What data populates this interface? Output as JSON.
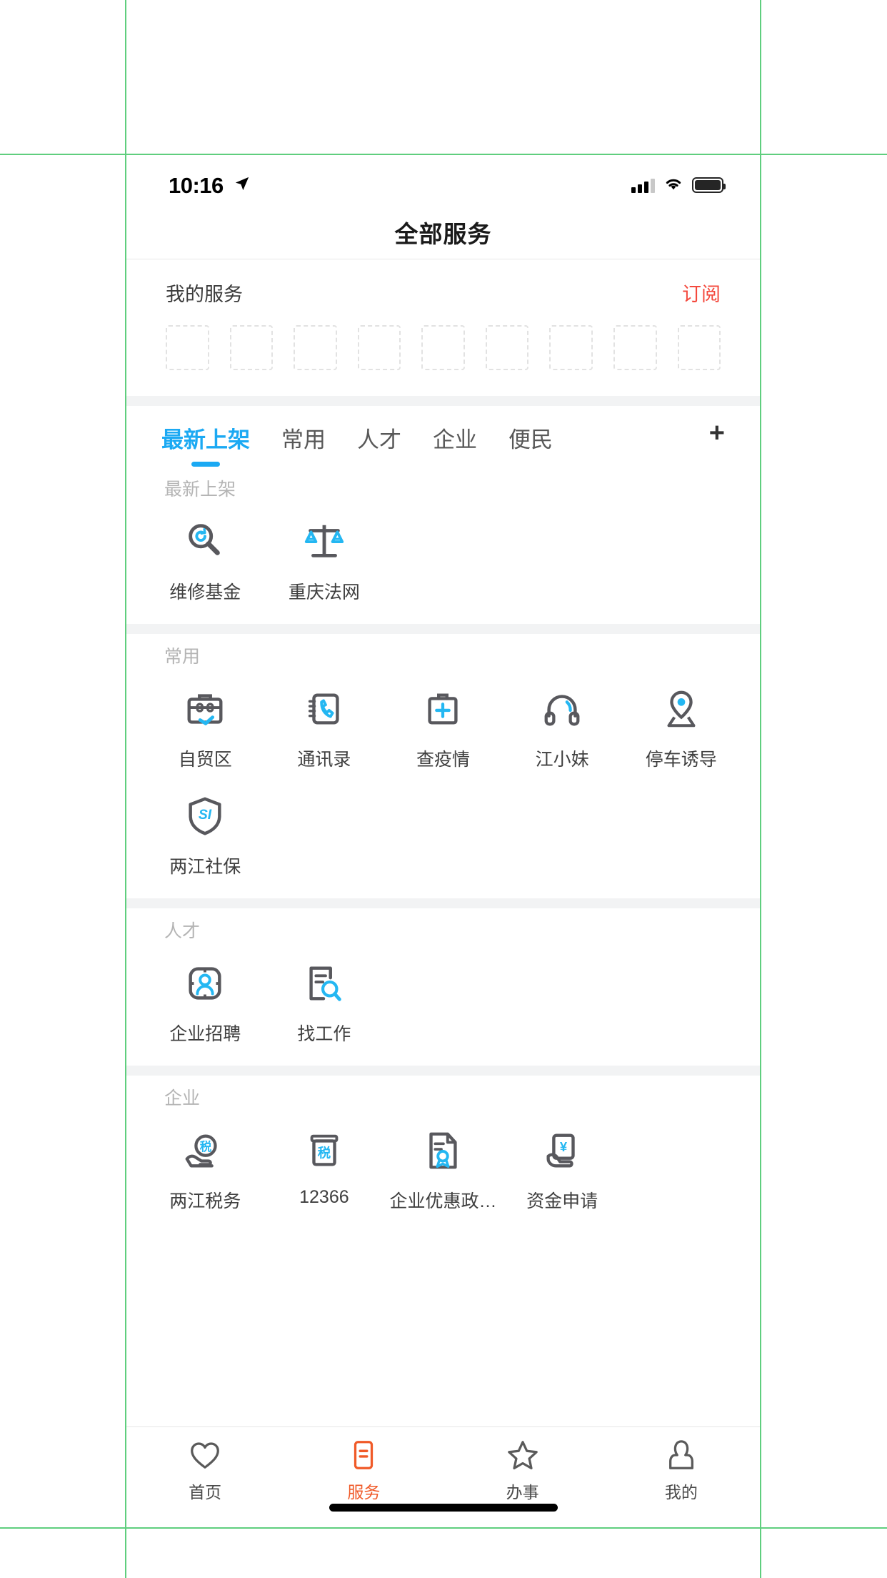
{
  "statusbar": {
    "time": "10:16",
    "location_icon": "location-arrow-icon",
    "signal_icon": "cellular-signal-icon",
    "wifi_icon": "wifi-icon",
    "battery_icon": "battery-icon"
  },
  "navbar": {
    "title": "全部服务"
  },
  "my_services": {
    "title": "我的服务",
    "subscribe_label": "订阅",
    "subscribe_color": "#f4493d",
    "empty_slots": 9
  },
  "tabs": {
    "items": [
      {
        "label": "最新上架",
        "active": true
      },
      {
        "label": "常用",
        "active": false
      },
      {
        "label": "人才",
        "active": false
      },
      {
        "label": "企业",
        "active": false
      },
      {
        "label": "便民",
        "active": false
      }
    ],
    "add_label": "+",
    "active_color": "#1ba9f3"
  },
  "sections": [
    {
      "title": "最新上架",
      "items": [
        {
          "label": "维修基金",
          "icon": "magnifier-refresh-icon"
        },
        {
          "label": "重庆法网",
          "icon": "balance-scale-icon"
        }
      ]
    },
    {
      "title": "常用",
      "items": [
        {
          "label": "自贸区",
          "icon": "briefcase-icon"
        },
        {
          "label": "通讯录",
          "icon": "contact-book-phone-icon"
        },
        {
          "label": "查疫情",
          "icon": "medical-kit-icon"
        },
        {
          "label": "江小妹",
          "icon": "headset-icon"
        },
        {
          "label": "停车诱导",
          "icon": "map-pin-icon"
        },
        {
          "label": "两江社保",
          "icon": "shield-si-icon"
        }
      ]
    },
    {
      "title": "人才",
      "items": [
        {
          "label": "企业招聘",
          "icon": "person-frame-icon"
        },
        {
          "label": "找工作",
          "icon": "document-search-icon"
        }
      ]
    },
    {
      "title": "企业",
      "items": [
        {
          "label": "两江税务",
          "icon": "hand-tax-icon"
        },
        {
          "label": "12366",
          "icon": "tax-jar-icon"
        },
        {
          "label": "企业优惠政…",
          "icon": "document-seal-icon"
        },
        {
          "label": "资金申请",
          "icon": "hand-yuan-icon"
        }
      ]
    }
  ],
  "tabbar": {
    "items": [
      {
        "label": "首页",
        "icon": "heart-icon",
        "active": false
      },
      {
        "label": "服务",
        "icon": "document-lines-icon",
        "active": true
      },
      {
        "label": "办事",
        "icon": "star-icon",
        "active": false
      },
      {
        "label": "我的",
        "icon": "person-icon",
        "active": false
      }
    ],
    "active_color": "#f05a28"
  }
}
